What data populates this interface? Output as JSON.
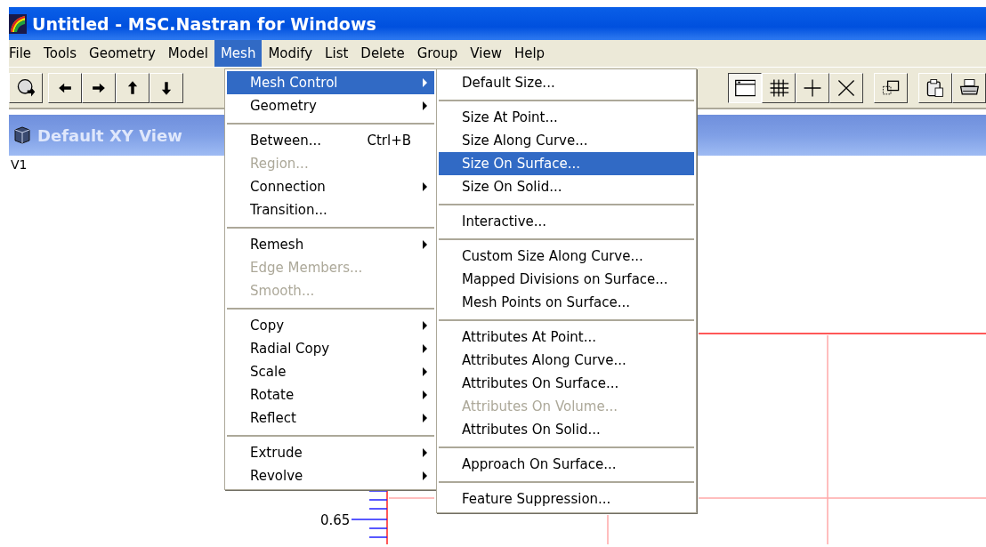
{
  "window": {
    "title": "Untitled - MSC.Nastran for Windows"
  },
  "menu_bar": [
    {
      "label": "File",
      "selected": false
    },
    {
      "label": "Tools",
      "selected": false
    },
    {
      "label": "Geometry",
      "selected": false
    },
    {
      "label": "Model",
      "selected": false
    },
    {
      "label": "Mesh",
      "selected": true
    },
    {
      "label": "Modify",
      "selected": false
    },
    {
      "label": "List",
      "selected": false
    },
    {
      "label": "Delete",
      "selected": false
    },
    {
      "label": "Group",
      "selected": false
    },
    {
      "label": "View",
      "selected": false
    },
    {
      "label": "Help",
      "selected": false
    }
  ],
  "toolbar_left": [
    {
      "kind": "rotate",
      "pressed": false
    },
    {
      "kind": "arrow-left",
      "pressed": false
    },
    {
      "kind": "arrow-right",
      "pressed": false
    },
    {
      "kind": "arrow-up",
      "pressed": false
    },
    {
      "kind": "arrow-down",
      "pressed": false
    }
  ],
  "toolbar_right": [
    {
      "kind": "window",
      "pressed": true
    },
    {
      "kind": "grid",
      "pressed": false
    },
    {
      "kind": "plus",
      "pressed": false
    },
    {
      "kind": "cross",
      "pressed": false
    },
    {
      "kind": "gap"
    },
    {
      "kind": "overlap",
      "pressed": false
    },
    {
      "kind": "gap"
    },
    {
      "kind": "clipboard",
      "pressed": false
    },
    {
      "kind": "printer",
      "pressed": false
    }
  ],
  "view": {
    "title": "Default XY View",
    "label": "V1",
    "axis_label": "0.65"
  },
  "mesh_menu": [
    {
      "kind": "item",
      "label": "Mesh Control",
      "submenu": true,
      "selected": true,
      "disabled": false
    },
    {
      "kind": "item",
      "label": "Geometry",
      "submenu": true,
      "selected": false,
      "disabled": false
    },
    {
      "kind": "separator"
    },
    {
      "kind": "item",
      "label": "Between...",
      "shortcut": "Ctrl+B",
      "submenu": false,
      "selected": false,
      "disabled": false
    },
    {
      "kind": "item",
      "label": "Region...",
      "submenu": false,
      "selected": false,
      "disabled": true
    },
    {
      "kind": "item",
      "label": "Connection",
      "submenu": true,
      "selected": false,
      "disabled": false
    },
    {
      "kind": "item",
      "label": "Transition...",
      "submenu": false,
      "selected": false,
      "disabled": false
    },
    {
      "kind": "separator"
    },
    {
      "kind": "item",
      "label": "Remesh",
      "submenu": true,
      "selected": false,
      "disabled": false
    },
    {
      "kind": "item",
      "label": "Edge Members...",
      "submenu": false,
      "selected": false,
      "disabled": true
    },
    {
      "kind": "item",
      "label": "Smooth...",
      "submenu": false,
      "selected": false,
      "disabled": true
    },
    {
      "kind": "separator"
    },
    {
      "kind": "item",
      "label": "Copy",
      "submenu": true,
      "selected": false,
      "disabled": false
    },
    {
      "kind": "item",
      "label": "Radial Copy",
      "submenu": true,
      "selected": false,
      "disabled": false
    },
    {
      "kind": "item",
      "label": "Scale",
      "submenu": true,
      "selected": false,
      "disabled": false
    },
    {
      "kind": "item",
      "label": "Rotate",
      "submenu": true,
      "selected": false,
      "disabled": false
    },
    {
      "kind": "item",
      "label": "Reflect",
      "submenu": true,
      "selected": false,
      "disabled": false
    },
    {
      "kind": "separator"
    },
    {
      "kind": "item",
      "label": "Extrude",
      "submenu": true,
      "selected": false,
      "disabled": false
    },
    {
      "kind": "item",
      "label": "Revolve",
      "submenu": true,
      "selected": false,
      "disabled": false
    }
  ],
  "mesh_control_menu": [
    {
      "kind": "item",
      "label": "Default Size...",
      "submenu": false,
      "selected": false,
      "disabled": false
    },
    {
      "kind": "separator"
    },
    {
      "kind": "item",
      "label": "Size At Point...",
      "submenu": false,
      "selected": false,
      "disabled": false
    },
    {
      "kind": "item",
      "label": "Size Along Curve...",
      "submenu": false,
      "selected": false,
      "disabled": false
    },
    {
      "kind": "item",
      "label": "Size On Surface...",
      "submenu": false,
      "selected": true,
      "disabled": false
    },
    {
      "kind": "item",
      "label": "Size On Solid...",
      "submenu": false,
      "selected": false,
      "disabled": false
    },
    {
      "kind": "separator"
    },
    {
      "kind": "item",
      "label": "Interactive...",
      "submenu": false,
      "selected": false,
      "disabled": false
    },
    {
      "kind": "separator"
    },
    {
      "kind": "item",
      "label": "Custom Size Along Curve...",
      "submenu": false,
      "selected": false,
      "disabled": false
    },
    {
      "kind": "item",
      "label": "Mapped Divisions on Surface...",
      "submenu": false,
      "selected": false,
      "disabled": false
    },
    {
      "kind": "item",
      "label": "Mesh Points on Surface...",
      "submenu": false,
      "selected": false,
      "disabled": false
    },
    {
      "kind": "separator"
    },
    {
      "kind": "item",
      "label": "Attributes At Point...",
      "submenu": false,
      "selected": false,
      "disabled": false
    },
    {
      "kind": "item",
      "label": "Attributes Along Curve...",
      "submenu": false,
      "selected": false,
      "disabled": false
    },
    {
      "kind": "item",
      "label": "Attributes On Surface...",
      "submenu": false,
      "selected": false,
      "disabled": false
    },
    {
      "kind": "item",
      "label": "Attributes On Volume...",
      "submenu": false,
      "selected": false,
      "disabled": true
    },
    {
      "kind": "item",
      "label": "Attributes On Solid...",
      "submenu": false,
      "selected": false,
      "disabled": false
    },
    {
      "kind": "separator"
    },
    {
      "kind": "item",
      "label": "Approach On Surface...",
      "submenu": false,
      "selected": false,
      "disabled": false
    },
    {
      "kind": "separator"
    },
    {
      "kind": "item",
      "label": "Feature Suppression...",
      "submenu": false,
      "selected": false,
      "disabled": false
    }
  ]
}
